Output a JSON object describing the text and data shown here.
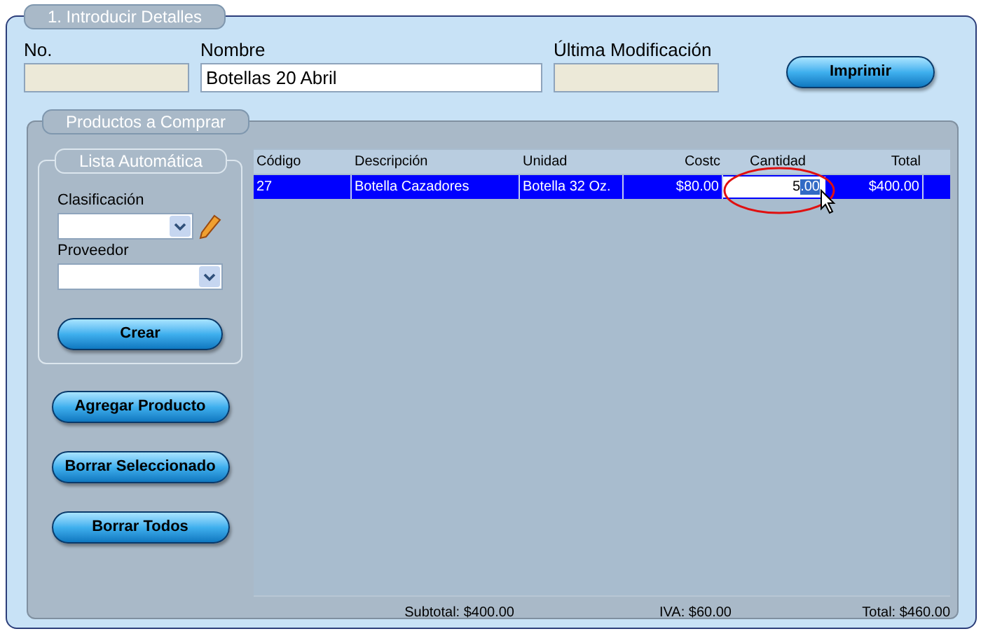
{
  "details": {
    "title": "1. Introducir Detalles",
    "fields": [
      {
        "label": "No.",
        "disabled": true
      },
      {
        "label": "Nombre",
        "value": "Botellas 20 Abril",
        "disabled": false
      },
      {
        "label": "Última Modificación",
        "disabled": true
      }
    ],
    "print_button": "Imprimir"
  },
  "products": {
    "title": "Productos a Comprar",
    "auto_list": {
      "title": "Lista Automática",
      "fields": [
        {
          "label": "Clasificación",
          "kind": "editable"
        },
        {
          "label": "Proveedor",
          "kind": "plain"
        }
      ],
      "create_button": "Crear"
    },
    "buttons": [
      "Agregar Producto",
      "Borrar Seleccionado",
      "Borrar Todos"
    ],
    "table": {
      "columns": [
        {
          "label": "Código"
        },
        {
          "label": "Descripción"
        },
        {
          "label": "Unidad"
        },
        {
          "label": "Costc"
        },
        {
          "label": "Cantidad"
        },
        {
          "label": "Total"
        }
      ],
      "rows": [
        {
          "selected": true,
          "cells": [
            {
              "text": "27",
              "editing": false
            },
            {
              "text": "Botella Cazadores",
              "editing": false
            },
            {
              "text": "Botella 32 Oz.",
              "editing": false
            },
            {
              "text": "$80.00",
              "editing": false
            },
            {
              "text": "5",
              "selection": ".00",
              "editing": true
            },
            {
              "text": "$400.00",
              "editing": false
            }
          ]
        }
      ]
    },
    "totals": [
      "Subtotal: $400.00",
      "IVA: $60.00",
      "Total: $460.00"
    ]
  }
}
